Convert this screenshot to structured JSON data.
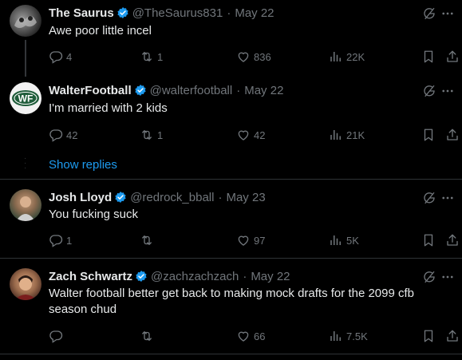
{
  "tweets": [
    {
      "name": "The Saurus",
      "handle": "@TheSaurus831",
      "date": "May 22",
      "text": "Awe poor little incel",
      "replies": "4",
      "reposts": "1",
      "likes": "836",
      "views": "22K"
    },
    {
      "name": "WalterFootball",
      "handle": "@walterfootball",
      "date": "May 22",
      "text": "I'm married with 2 kids",
      "replies": "42",
      "reposts": "1",
      "likes": "42",
      "views": "21K"
    },
    {
      "name": "Josh Lloyd",
      "handle": "@redrock_bball",
      "date": "May 23",
      "text": "You fucking suck",
      "replies": "1",
      "reposts": "",
      "likes": "97",
      "views": "5K"
    },
    {
      "name": "Zach Schwartz",
      "handle": "@zachzachzach",
      "date": "May 22",
      "text": "Walter football better get back to making mock drafts for the 2099 cfb season  chud",
      "replies": "",
      "reposts": "",
      "likes": "66",
      "views": "7.5K"
    }
  ],
  "show_replies": "Show replies",
  "avatar_logo_text": "WF",
  "colors": {
    "background": "#000000",
    "text": "#e7e9ea",
    "muted": "#71767b",
    "accent": "#1d9bf0",
    "divider": "#2f3336"
  }
}
